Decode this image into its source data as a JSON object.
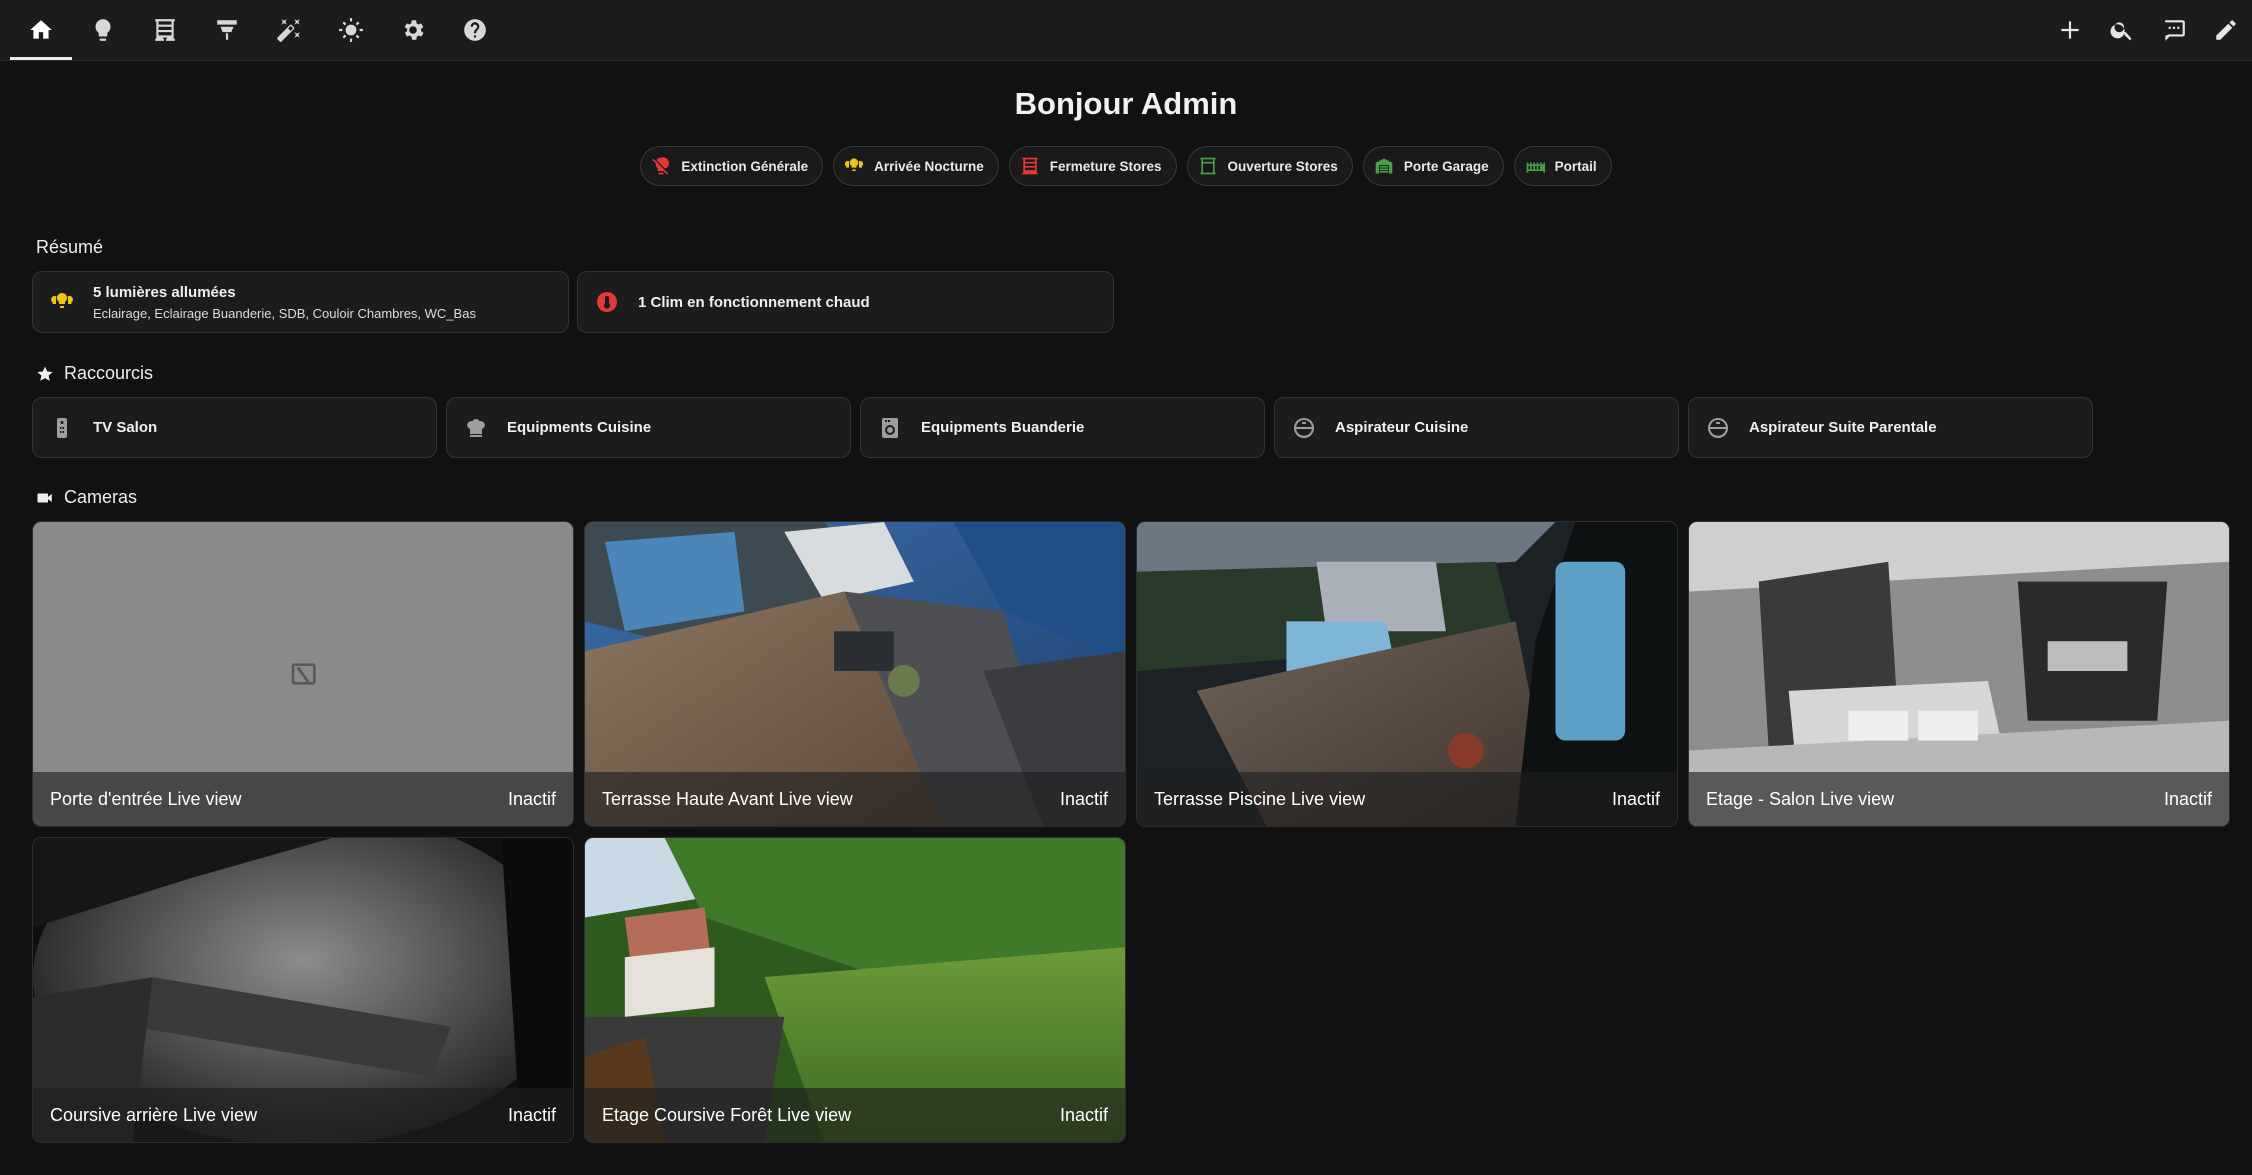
{
  "nav": {
    "tabs": [
      {
        "icon": "home-icon"
      },
      {
        "icon": "lightbulb-icon"
      },
      {
        "icon": "blinds-icon"
      },
      {
        "icon": "ceiling-fixture-icon"
      },
      {
        "icon": "magic-wand-icon"
      },
      {
        "icon": "sun-icon"
      },
      {
        "icon": "gear-icon"
      },
      {
        "icon": "help-circle-icon"
      }
    ],
    "actions": [
      {
        "icon": "plus-icon"
      },
      {
        "icon": "search-icon"
      },
      {
        "icon": "assist-chat-icon"
      },
      {
        "icon": "pencil-icon"
      }
    ]
  },
  "greeting": "Bonjour Admin",
  "chips": [
    {
      "label": "Extinction Générale",
      "icon": "lightbulb-off-icon",
      "color": "#e53935"
    },
    {
      "label": "Arrivée Nocturne",
      "icon": "lightbulb-group-icon",
      "color": "#f1c40f"
    },
    {
      "label": "Fermeture Stores",
      "icon": "blinds-closed-icon",
      "color": "#e53935"
    },
    {
      "label": "Ouverture Stores",
      "icon": "blinds-open-icon",
      "color": "#43a047"
    },
    {
      "label": "Porte Garage",
      "icon": "garage-icon",
      "color": "#43a047"
    },
    {
      "label": "Portail",
      "icon": "gate-icon",
      "color": "#43a047"
    }
  ],
  "summary": {
    "title": "Résumé",
    "cards": [
      {
        "title": "5 lumières allumées",
        "subtitle": "Eclairage, Eclairage Buanderie, SDB, Couloir Chambres, WC_Bas",
        "icon": "lightbulb-group-icon",
        "color": "#f1c40f"
      },
      {
        "title": "1 Clim en fonctionnement chaud",
        "subtitle": "",
        "icon": "thermostat-icon",
        "color": "#e53935"
      }
    ]
  },
  "shortcuts": {
    "title": "Raccourcis",
    "icon": "star-icon",
    "items": [
      {
        "label": "TV Salon",
        "icon": "remote-control-icon"
      },
      {
        "label": "Equipments Cuisine",
        "icon": "chef-hat-icon"
      },
      {
        "label": "Equipments Buanderie",
        "icon": "washing-machine-icon"
      },
      {
        "label": "Aspirateur Cuisine",
        "icon": "robot-vacuum-icon"
      },
      {
        "label": "Aspirateur Suite Parentale",
        "icon": "robot-vacuum-icon"
      }
    ]
  },
  "cameras": {
    "title": "Cameras",
    "icon": "video-icon",
    "items": [
      {
        "name": "Porte d'entrée Live view",
        "state": "Inactif"
      },
      {
        "name": "Terrasse Haute Avant Live view",
        "state": "Inactif"
      },
      {
        "name": "Terrasse Piscine Live view",
        "state": "Inactif"
      },
      {
        "name": "Etage - Salon Live view",
        "state": "Inactif"
      },
      {
        "name": "Coursive arrière Live view",
        "state": "Inactif"
      },
      {
        "name": "Etage Coursive Forêt Live view",
        "state": "Inactif"
      }
    ]
  }
}
